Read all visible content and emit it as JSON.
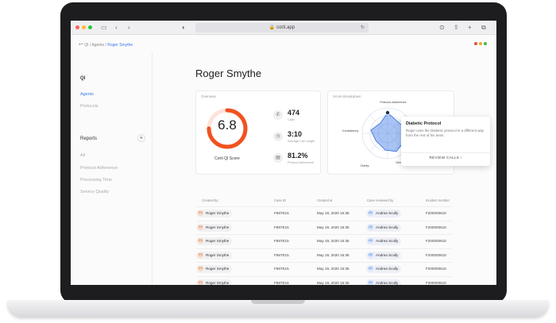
{
  "browser": {
    "url": "corti.app"
  },
  "breadcrumb": {
    "root": "QI",
    "section": "Agents",
    "current": "Roger Smythe"
  },
  "sidebar": {
    "qi_heading": "QI",
    "qi_items": [
      "Agents",
      "Protocols"
    ],
    "reports_heading": "Reports",
    "reports_items": [
      "All",
      "Protocol Adherence",
      "Processing Time",
      "Service Quality"
    ]
  },
  "page": {
    "title": "Roger Smythe"
  },
  "overview": {
    "label": "Overview",
    "score": "6.8",
    "score_label": "Corti QI Score",
    "score_fraction": 0.75,
    "stats": [
      {
        "value": "474",
        "label": "Calls"
      },
      {
        "value": "3:10",
        "label": "Average Call Length"
      },
      {
        "value": "81.2%",
        "label": "Protocol Adherence"
      }
    ]
  },
  "breakdown": {
    "label": "Score Breakdown",
    "axes": [
      "Protocol Adherence",
      "Consistency",
      "Clarity",
      "Service Quality"
    ]
  },
  "tooltip": {
    "title": "Diabetic Protocol",
    "body": "Roger uses the Diabetic protocol in a different way from the rest of his team.",
    "action": "REVIEW CALLS"
  },
  "table": {
    "headers": [
      "Created by",
      "Case ID",
      "Created at",
      "Case reviewed by",
      "Incident number"
    ],
    "rows": [
      {
        "creator_initials": "RS",
        "creator": "Roger Smythe",
        "case_id": "F687E15",
        "created_at": "May 19, 2020 15:36",
        "reviewer_initials": "AS",
        "reviewer": "Andrea Scully",
        "incident": "F200000610"
      },
      {
        "creator_initials": "RS",
        "creator": "Roger Smythe",
        "case_id": "F687E15",
        "created_at": "May 19, 2020 15:36",
        "reviewer_initials": "AS",
        "reviewer": "Andrea Scully",
        "incident": "F200000610"
      },
      {
        "creator_initials": "RS",
        "creator": "Roger Smythe",
        "case_id": "F687E15",
        "created_at": "May 19, 2020 15:36",
        "reviewer_initials": "AS",
        "reviewer": "Andrea Scully",
        "incident": "F200000610"
      },
      {
        "creator_initials": "RS",
        "creator": "Roger Smythe",
        "case_id": "F687E15",
        "created_at": "May 19, 2020 15:36",
        "reviewer_initials": "AS",
        "reviewer": "Andrea Scully",
        "incident": "F200000610"
      },
      {
        "creator_initials": "RS",
        "creator": "Roger Smythe",
        "case_id": "F687E15",
        "created_at": "May 19, 2020 15:36",
        "reviewer_initials": "AS",
        "reviewer": "Andrea Scully",
        "incident": "F200000610"
      },
      {
        "creator_initials": "RS",
        "creator": "Roger Smythe",
        "case_id": "F687E15",
        "created_at": "May 19, 2020 15:36",
        "reviewer_initials": "AS",
        "reviewer": "Andrea Scully",
        "incident": "F200000610"
      }
    ]
  },
  "colors": {
    "accent": "#3d7be6",
    "score_ring": "#f0531f",
    "radar_fill": "#3d7be6",
    "radar_marker": "#16324f"
  }
}
